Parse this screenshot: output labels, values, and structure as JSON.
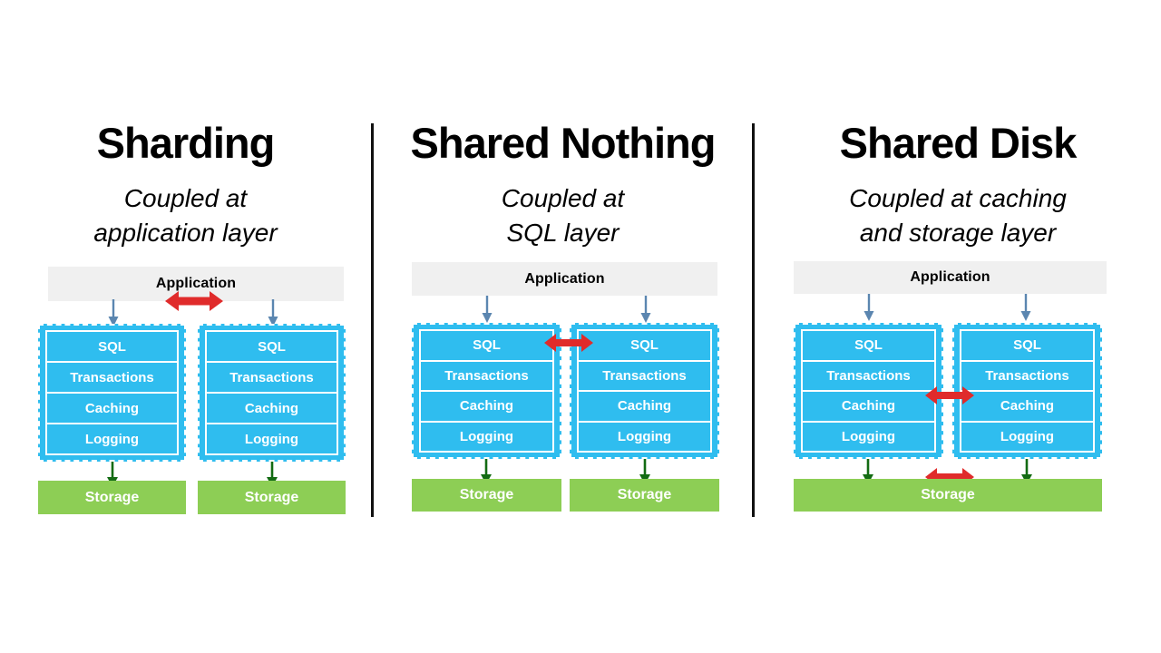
{
  "diagram": {
    "title_semantic": "database-scaling-architectures-comparison",
    "layer_labels": [
      "SQL",
      "Transactions",
      "Caching",
      "Logging"
    ],
    "app_label": "Application",
    "storage_label": "Storage",
    "colors": {
      "node_fill": "#2fbdef",
      "storage_fill": "#8dce55",
      "app_fill": "#f0f0f0",
      "coupling_arrow": "#e02b2b",
      "flow_arrow_app": "#5b86b0",
      "flow_arrow_storage": "#136b13",
      "separator": "#111111",
      "background": "#ffffff"
    }
  },
  "columns": [
    {
      "id": "sharding",
      "title": "Sharding",
      "subtitle": "Coupled at\napplication layer",
      "subtitle_line1": "Coupled at",
      "subtitle_line2": "application layer",
      "app_label": "Application",
      "coupling_point": "application",
      "shared_storage": false,
      "nodes": [
        {
          "name": "node-left",
          "layers": [
            "SQL",
            "Transactions",
            "Caching",
            "Logging"
          ]
        },
        {
          "name": "node-right",
          "layers": [
            "SQL",
            "Transactions",
            "Caching",
            "Logging"
          ]
        }
      ],
      "storages": [
        "Storage",
        "Storage"
      ]
    },
    {
      "id": "shared-nothing",
      "title": "Shared Nothing",
      "subtitle": "Coupled at\nSQL layer",
      "subtitle_line1": "Coupled at",
      "subtitle_line2": "SQL layer",
      "app_label": "Application",
      "coupling_point": "sql",
      "shared_storage": false,
      "nodes": [
        {
          "name": "node-left",
          "layers": [
            "SQL",
            "Transactions",
            "Caching",
            "Logging"
          ]
        },
        {
          "name": "node-right",
          "layers": [
            "SQL",
            "Transactions",
            "Caching",
            "Logging"
          ]
        }
      ],
      "storages": [
        "Storage",
        "Storage"
      ]
    },
    {
      "id": "shared-disk",
      "title": "Shared Disk",
      "subtitle": "Coupled at caching\nand storage layer",
      "subtitle_line1": "Coupled at caching",
      "subtitle_line2": "and storage layer",
      "app_label": "Application",
      "coupling_point": "caching-and-storage",
      "shared_storage": true,
      "nodes": [
        {
          "name": "node-left",
          "layers": [
            "SQL",
            "Transactions",
            "Caching",
            "Logging"
          ]
        },
        {
          "name": "node-right",
          "layers": [
            "SQL",
            "Transactions",
            "Caching",
            "Logging"
          ]
        }
      ],
      "storages": [
        "Storage"
      ]
    }
  ]
}
